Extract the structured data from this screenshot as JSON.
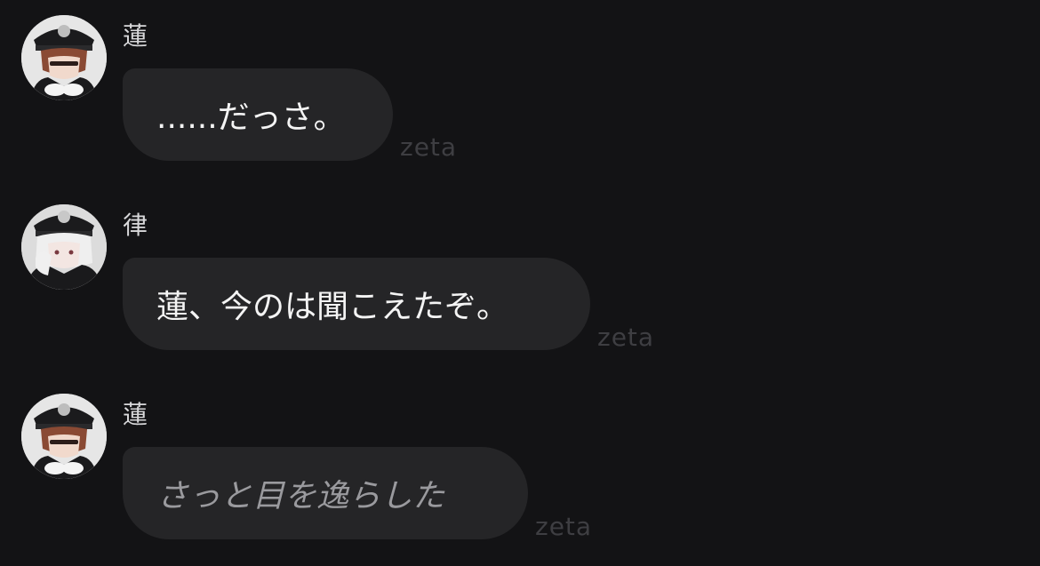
{
  "messages": [
    {
      "sender": "蓮",
      "text": "......だっさ。",
      "style": "speech",
      "watermark": "zeta",
      "avatar_icon": "ren-avatar-icon"
    },
    {
      "sender": "律",
      "text": "蓮、今のは聞こえたぞ。",
      "style": "speech",
      "watermark": "zeta",
      "avatar_icon": "ritsu-avatar-icon"
    },
    {
      "sender": "蓮",
      "text": "さっと目を逸らした",
      "style": "action",
      "watermark": "zeta",
      "avatar_icon": "ren-avatar-icon"
    }
  ],
  "colors": {
    "background": "#131315",
    "bubble": "#252527",
    "name_text": "#d8d8da",
    "message_text": "#f4f4f4",
    "action_text": "#9a9a9e",
    "watermark": "#3e3e42"
  }
}
